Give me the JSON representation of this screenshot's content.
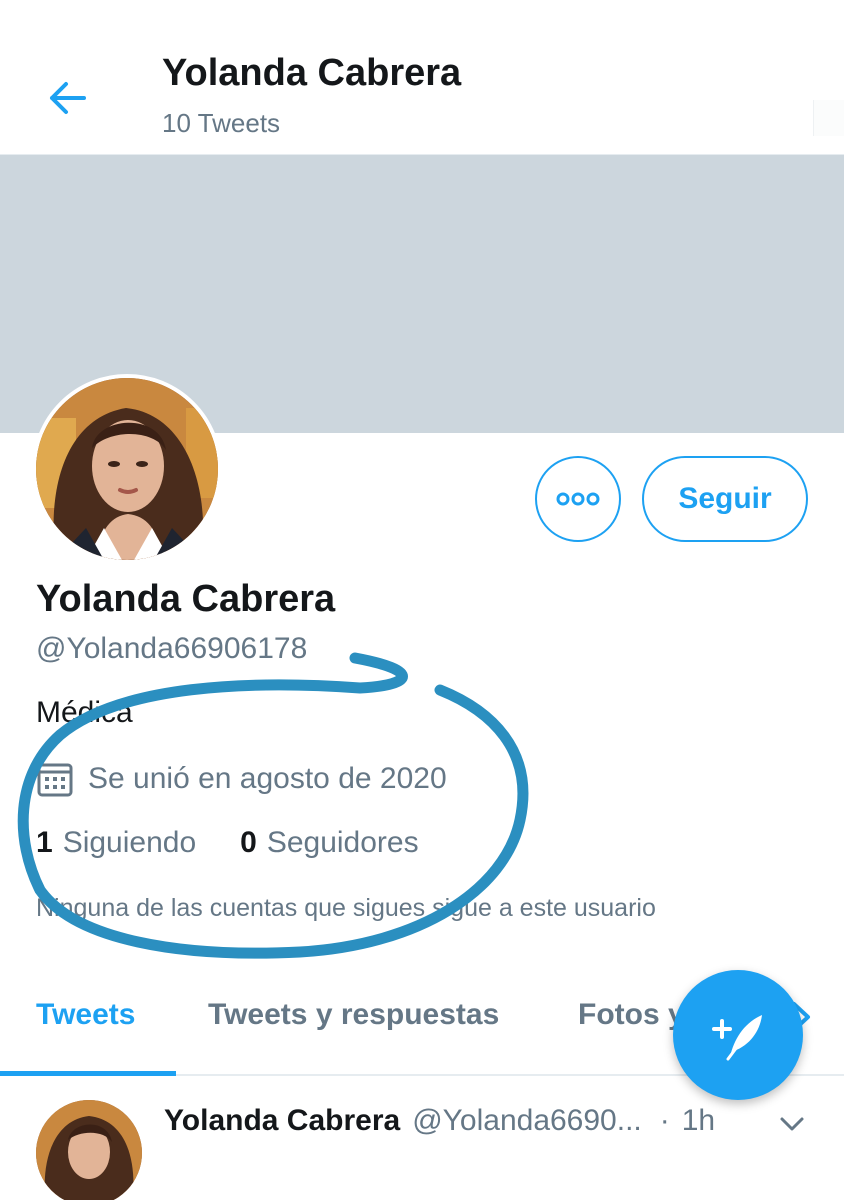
{
  "header": {
    "title": "Yolanda Cabrera",
    "tweet_count": "10 Tweets",
    "back_icon": "arrow-left-icon"
  },
  "profile": {
    "name": "Yolanda Cabrera",
    "handle": "@Yolanda66906178",
    "bio": "Médica",
    "joined": "Se unió en agosto de 2020",
    "following_count": "1",
    "following_label": "Siguiendo",
    "followers_count": "0",
    "followers_label": "Seguidores",
    "followers_note": "Ninguna de las cuentas que sigues sigue a este usuario"
  },
  "actions": {
    "follow_label": "Seguir",
    "more_icon": "more-options-icon"
  },
  "tabs": [
    {
      "label": "Tweets",
      "active": true
    },
    {
      "label": "Tweets y respuestas",
      "active": false
    },
    {
      "label": "Fotos y",
      "active": false
    }
  ],
  "tweet": {
    "name": "Yolanda Cabrera",
    "handle": "@Yolanda6690...",
    "separator": "·",
    "time": "1h"
  },
  "fab": {
    "icon": "compose-tweet-icon"
  },
  "colors": {
    "accent": "#1da1f2",
    "secondary_text": "#657786",
    "banner": "#ccd6dd",
    "annotation": "#2b8fc0"
  }
}
